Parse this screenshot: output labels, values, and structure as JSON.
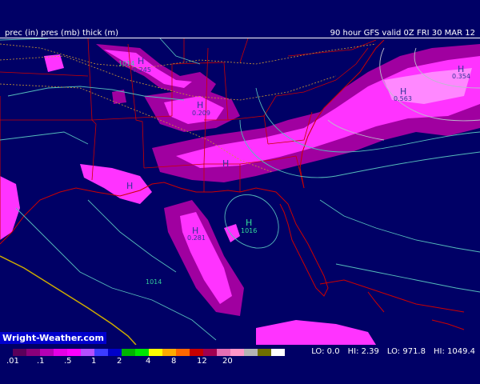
{
  "header": {
    "left_title": "prec (in)  pres (mb)  thick (m)",
    "right_title": "90 hour GFS valid 0Z FRI 30 MAR 12"
  },
  "credit": "Wright-Weather.com",
  "legend": {
    "colors": [
      "#5a005a",
      "#8a007a",
      "#b400b4",
      "#e600e6",
      "#ff00ff",
      "#b450ff",
      "#3c3cff",
      "#0000c8",
      "#00b400",
      "#00e600",
      "#ffff00",
      "#ffaa00",
      "#ff6600",
      "#c80000",
      "#a00050",
      "#e66eb4",
      "#ff96c8",
      "#b4b4b4",
      "#6e6e00",
      "#ffffff"
    ],
    "labels": [
      ".01",
      ".1",
      ".5",
      "1",
      "2",
      "4",
      "8",
      "12",
      "20"
    ]
  },
  "stats": {
    "lo_precip": "LO:   0.0",
    "hi_precip": "HI:  2.39",
    "lo_pres": "LO: 971.8",
    "hi_pres": "HI: 1049.4"
  },
  "highs": [
    {
      "value": "0.245",
      "letter": "H"
    },
    {
      "value": "0.209",
      "letter": "H"
    },
    {
      "value": "0.563",
      "letter": "H"
    },
    {
      "value": "0.354",
      "letter": "H"
    },
    {
      "value": "1016",
      "letter": "H"
    },
    {
      "value": "0.281",
      "letter": "H"
    }
  ],
  "isobar_labels": [
    "1014",
    "1014"
  ]
}
